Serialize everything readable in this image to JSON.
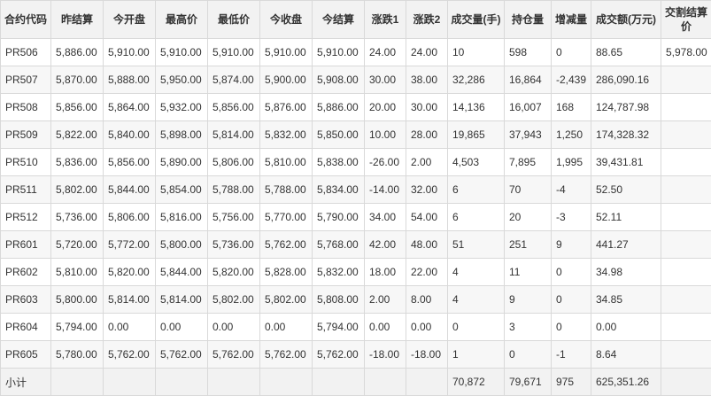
{
  "table": {
    "headers": [
      "合约代码",
      "昨结算",
      "今开盘",
      "最高价",
      "最低价",
      "今收盘",
      "今结算",
      "涨跌1",
      "涨跌2",
      "成交量(手)",
      "持仓量",
      "增减量",
      "成交额(万元)",
      "交割结算价"
    ],
    "rows": [
      [
        "PR506",
        "5,886.00",
        "5,910.00",
        "5,910.00",
        "5,910.00",
        "5,910.00",
        "5,910.00",
        "24.00",
        "24.00",
        "10",
        "598",
        "0",
        "88.65",
        "5,978.00"
      ],
      [
        "PR507",
        "5,870.00",
        "5,888.00",
        "5,950.00",
        "5,874.00",
        "5,900.00",
        "5,908.00",
        "30.00",
        "38.00",
        "32,286",
        "16,864",
        "-2,439",
        "286,090.16",
        ""
      ],
      [
        "PR508",
        "5,856.00",
        "5,864.00",
        "5,932.00",
        "5,856.00",
        "5,876.00",
        "5,886.00",
        "20.00",
        "30.00",
        "14,136",
        "16,007",
        "168",
        "124,787.98",
        ""
      ],
      [
        "PR509",
        "5,822.00",
        "5,840.00",
        "5,898.00",
        "5,814.00",
        "5,832.00",
        "5,850.00",
        "10.00",
        "28.00",
        "19,865",
        "37,943",
        "1,250",
        "174,328.32",
        ""
      ],
      [
        "PR510",
        "5,836.00",
        "5,856.00",
        "5,890.00",
        "5,806.00",
        "5,810.00",
        "5,838.00",
        "-26.00",
        "2.00",
        "4,503",
        "7,895",
        "1,995",
        "39,431.81",
        ""
      ],
      [
        "PR511",
        "5,802.00",
        "5,844.00",
        "5,854.00",
        "5,788.00",
        "5,788.00",
        "5,834.00",
        "-14.00",
        "32.00",
        "6",
        "70",
        "-4",
        "52.50",
        ""
      ],
      [
        "PR512",
        "5,736.00",
        "5,806.00",
        "5,816.00",
        "5,756.00",
        "5,770.00",
        "5,790.00",
        "34.00",
        "54.00",
        "6",
        "20",
        "-3",
        "52.11",
        ""
      ],
      [
        "PR601",
        "5,720.00",
        "5,772.00",
        "5,800.00",
        "5,736.00",
        "5,762.00",
        "5,768.00",
        "42.00",
        "48.00",
        "51",
        "251",
        "9",
        "441.27",
        ""
      ],
      [
        "PR602",
        "5,810.00",
        "5,820.00",
        "5,844.00",
        "5,820.00",
        "5,828.00",
        "5,832.00",
        "18.00",
        "22.00",
        "4",
        "11",
        "0",
        "34.98",
        ""
      ],
      [
        "PR603",
        "5,800.00",
        "5,814.00",
        "5,814.00",
        "5,802.00",
        "5,802.00",
        "5,808.00",
        "2.00",
        "8.00",
        "4",
        "9",
        "0",
        "34.85",
        ""
      ],
      [
        "PR604",
        "5,794.00",
        "0.00",
        "0.00",
        "0.00",
        "0.00",
        "5,794.00",
        "0.00",
        "0.00",
        "0",
        "3",
        "0",
        "0.00",
        ""
      ],
      [
        "PR605",
        "5,780.00",
        "5,762.00",
        "5,762.00",
        "5,762.00",
        "5,762.00",
        "5,762.00",
        "-18.00",
        "-18.00",
        "1",
        "0",
        "-1",
        "8.64",
        ""
      ]
    ],
    "subtotal": [
      "小计",
      "",
      "",
      "",
      "",
      "",
      "",
      "",
      "",
      "70,872",
      "79,671",
      "975",
      "625,351.26",
      ""
    ]
  }
}
